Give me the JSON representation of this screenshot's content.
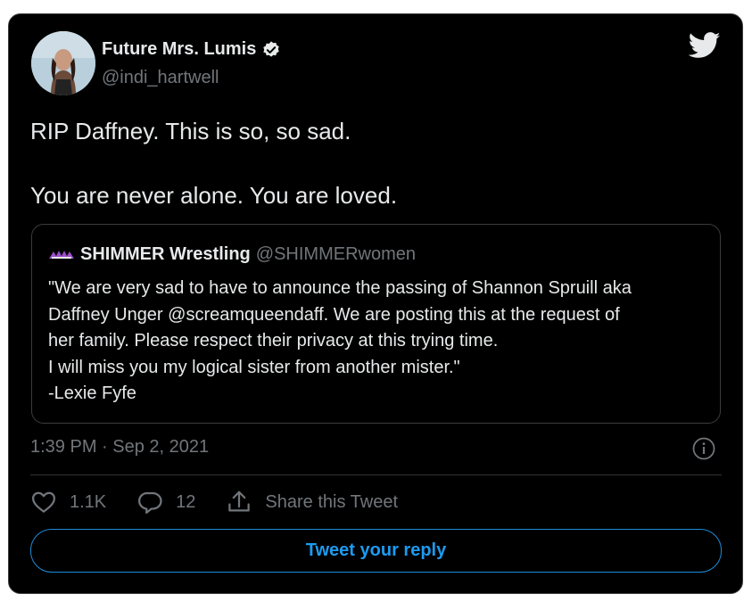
{
  "author": {
    "name": "Future Mrs. Lumis",
    "handle": "@indi_hartwell",
    "verified_icon": "verified-badge-icon",
    "avatar": "profile-photo"
  },
  "platform_icon": "twitter-bird-icon",
  "tweet": {
    "line1": "RIP Daffney. This is so, so sad.",
    "line2": "You are never alone. You are loved."
  },
  "quoted_tweet": {
    "name": "SHIMMER Wrestling",
    "handle": "@SHIMMERwomen",
    "logo": "shimmer-logo-icon",
    "lines": [
      "\"We are very sad to have to announce the passing of Shannon Spruill aka",
      "Daffney Unger @screamqueendaff.  We are posting this at the request of",
      "her family.  Please respect their privacy at this trying time.",
      "I will miss you my logical sister from another mister.\"",
      "-Lexie Fyfe"
    ]
  },
  "meta": {
    "timestamp": "1:39 PM · Sep 2, 2021",
    "info_icon": "info-icon"
  },
  "actions": {
    "likes": "1.1K",
    "replies": "12",
    "share_label": "Share this Tweet"
  },
  "reply_button": "Tweet your reply",
  "colors": {
    "background": "#000000",
    "text": "#e7e9ea",
    "muted": "#71767b",
    "accent": "#1d9bf0",
    "border": "#3a3d40"
  }
}
